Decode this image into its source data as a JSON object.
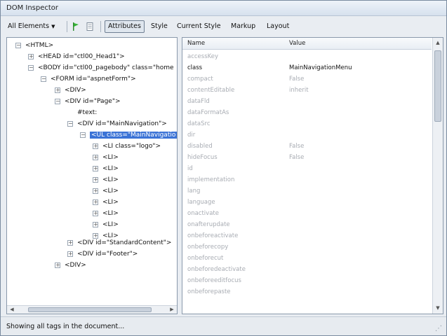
{
  "window": {
    "title": "DOM Inspector"
  },
  "toolbar": {
    "filter": "All Elements",
    "tabs": [
      "Attributes",
      "Style",
      "Current Style",
      "Markup",
      "Layout"
    ],
    "active_tab": "Attributes"
  },
  "tree": [
    "<HTML>",
    "<HEAD id=\"ctl00_Head1\">",
    "<BODY id=\"ctl00_pagebody\" class=\"home",
    "<FORM id=\"aspnetForm\">",
    "<DIV>",
    "<DIV id=\"Page\">",
    "#text:",
    "<DIV id=\"MainNavigation\">",
    "<UL class=\"MainNavigatio",
    "<LI class=\"logo\">",
    "<LI>",
    "<LI>",
    "<LI>",
    "<LI>",
    "<LI>",
    "<LI>",
    "<LI>",
    "<LI>",
    "<DIV id=\"StandardContent\">",
    "<DIV id=\"Footer\">",
    "<DIV>"
  ],
  "attributes": {
    "headers": [
      "Name",
      "Value"
    ],
    "rows": [
      {
        "name": "accessKey",
        "value": ""
      },
      {
        "name": "class",
        "value": "MainNavigationMenu",
        "set": true
      },
      {
        "name": "compact",
        "value": "False"
      },
      {
        "name": "contentEditable",
        "value": "inherit"
      },
      {
        "name": "dataFld",
        "value": ""
      },
      {
        "name": "dataFormatAs",
        "value": ""
      },
      {
        "name": "dataSrc",
        "value": ""
      },
      {
        "name": "dir",
        "value": ""
      },
      {
        "name": "disabled",
        "value": "False"
      },
      {
        "name": "hideFocus",
        "value": "False"
      },
      {
        "name": "id",
        "value": ""
      },
      {
        "name": "implementation",
        "value": ""
      },
      {
        "name": "lang",
        "value": ""
      },
      {
        "name": "language",
        "value": ""
      },
      {
        "name": "onactivate",
        "value": ""
      },
      {
        "name": "onafterupdate",
        "value": ""
      },
      {
        "name": "onbeforeactivate",
        "value": ""
      },
      {
        "name": "onbeforecopy",
        "value": ""
      },
      {
        "name": "onbeforecut",
        "value": ""
      },
      {
        "name": "onbeforedeactivate",
        "value": ""
      },
      {
        "name": "onbeforeeditfocus",
        "value": ""
      },
      {
        "name": "onbeforepaste",
        "value": ""
      }
    ]
  },
  "status": {
    "text": "Showing all tags in the document..."
  }
}
